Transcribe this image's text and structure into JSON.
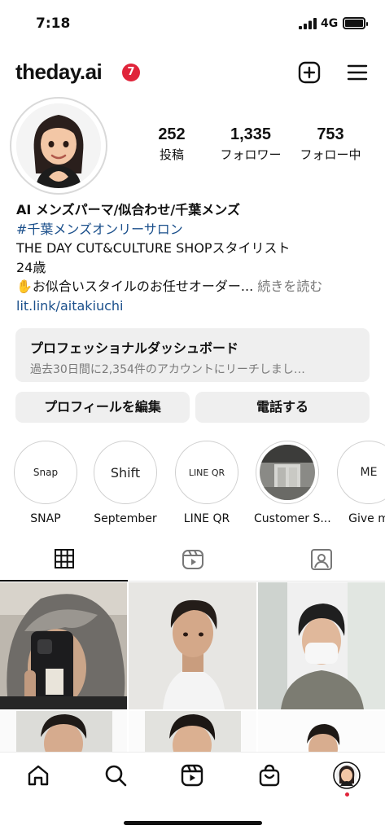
{
  "status": {
    "time": "7:18",
    "network": "4G"
  },
  "header": {
    "username": "theday.ai",
    "notification_count": "7"
  },
  "stats": [
    {
      "value": "252",
      "label": "投稿"
    },
    {
      "value": "1,335",
      "label": "フォロワー"
    },
    {
      "value": "753",
      "label": "フォロー中"
    }
  ],
  "bio": {
    "name": "AI メンズパーマ/似合わせ/千葉メンズ",
    "hashtag": "#千葉メンズオンリーサロン",
    "line1": "THE DAY CUT&CULTURE SHOPスタイリスト",
    "line2": "24歳",
    "line3": "✋お似合いスタイルのお任せオーダー...",
    "more": " 続きを読む",
    "link": "lit.link/aitakiuchi"
  },
  "dashboard": {
    "title": "プロフェッショナルダッシュボード",
    "subtitle": "過去30日間に2,354件のアカウントにリーチしまし…"
  },
  "buttons": {
    "edit_profile": "プロフィールを編集",
    "call": "電話する"
  },
  "highlights": [
    {
      "inner": "Snap",
      "caption": "SNAP"
    },
    {
      "inner": "Shift",
      "caption": "September"
    },
    {
      "inner": "LINE QR",
      "caption": "LINE QR"
    },
    {
      "inner": "",
      "caption": "Customer S..."
    },
    {
      "inner": "ME",
      "caption": "Give m"
    }
  ],
  "colors": {
    "link": "#1a4f8b",
    "badge": "#e0243a",
    "button_bg": "#efefef"
  },
  "icons": {
    "header": [
      "new-post-icon",
      "menu-icon"
    ],
    "tabs": [
      "grid-icon",
      "reels-icon",
      "tagged-icon"
    ],
    "bottom_nav": [
      "home-icon",
      "search-icon",
      "reels-icon",
      "shop-icon",
      "profile-avatar"
    ]
  }
}
